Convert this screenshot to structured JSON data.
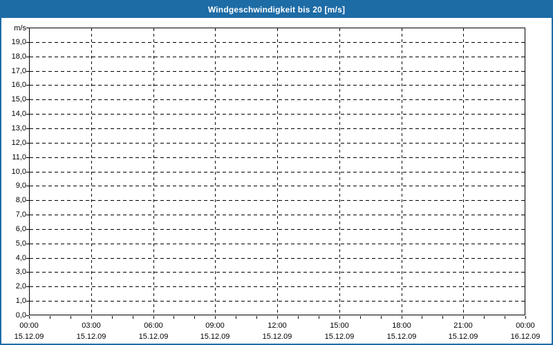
{
  "window": {
    "title": "Windgeschwindigkeit bis 20 [m/s]"
  },
  "colors": {
    "accent_blue": "#1e6ca6",
    "grid_line": "#000000",
    "label_text": "#000000",
    "title_text": "#ffffff",
    "background": "#ffffff"
  },
  "chart_data": {
    "type": "line",
    "title": "Windgeschwindigkeit bis 20 [m/s]",
    "grid": "dashed",
    "legend": "none",
    "series": [],
    "y_axis": {
      "unit_label": "m/s",
      "min": 0,
      "max": 20,
      "tick_step": 1,
      "tick_labels": [
        "19,0",
        "18,0",
        "17,0",
        "16,0",
        "15,0",
        "14,0",
        "13,0",
        "12,0",
        "11,0",
        "10,0",
        "9,0",
        "8,0",
        "7,0",
        "6,0",
        "5,0",
        "4,0",
        "3,0",
        "2,0",
        "1,0",
        "0,0"
      ]
    },
    "x_axis": {
      "min_hours": 0,
      "max_hours": 24,
      "major_tick_step_hours": 3,
      "minor_tick_step_hours": 1,
      "tick_labels": [
        {
          "time": "00:00",
          "date": "15.12.09"
        },
        {
          "time": "03:00",
          "date": "15.12.09"
        },
        {
          "time": "06:00",
          "date": "15.12.09"
        },
        {
          "time": "09:00",
          "date": "15.12.09"
        },
        {
          "time": "12:00",
          "date": "15.12.09"
        },
        {
          "time": "15:00",
          "date": "15.12.09"
        },
        {
          "time": "18:00",
          "date": "15.12.09"
        },
        {
          "time": "21:00",
          "date": "15.12.09"
        },
        {
          "time": "00:00",
          "date": "16.12.09"
        }
      ]
    }
  }
}
